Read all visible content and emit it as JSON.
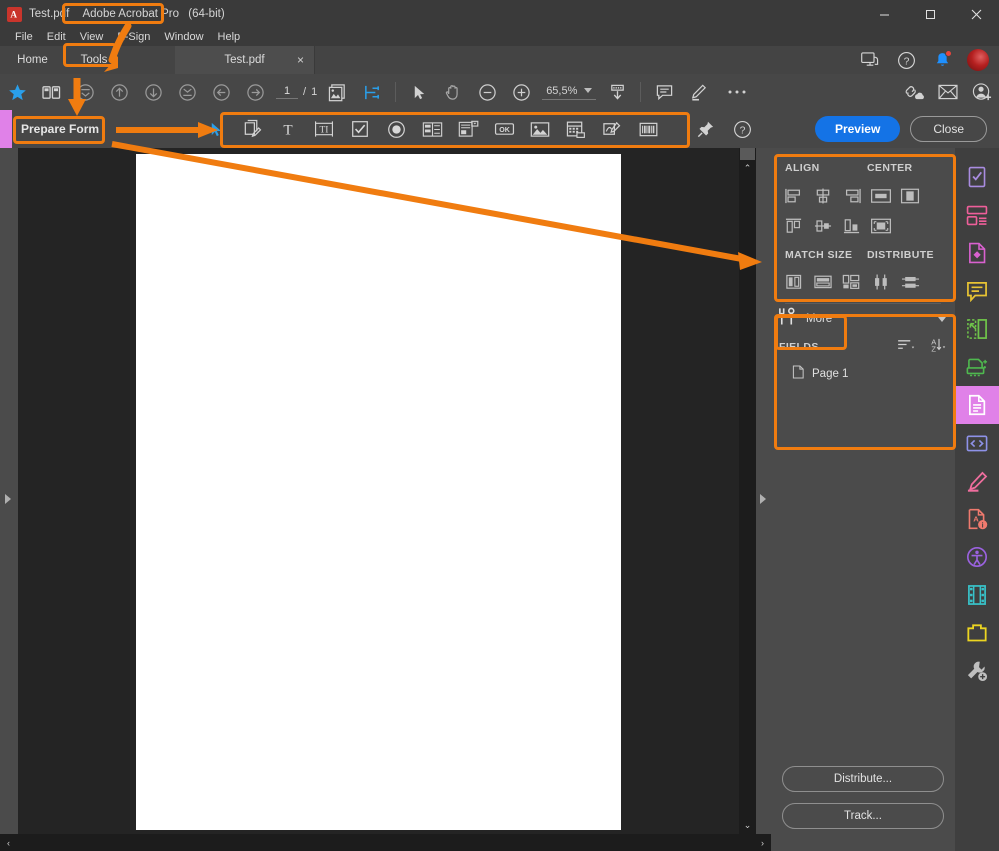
{
  "window": {
    "app_icon": "acrobat-logo-icon",
    "title_file": "Test.pdf",
    "title_app": "Adobe Acrobat Pro",
    "title_suffix": "(64-bit)",
    "minimize": "minimize-icon",
    "maximize": "maximize-icon",
    "close": "close-icon"
  },
  "menu": {
    "items": [
      {
        "label": "File"
      },
      {
        "label": "Edit"
      },
      {
        "label": "View"
      },
      {
        "label": "E-Sign"
      },
      {
        "label": "Window"
      },
      {
        "label": "Help"
      }
    ]
  },
  "tabs": {
    "home": "Home",
    "tools": "Tools",
    "document": "Test.pdf",
    "close_glyph": "×",
    "right_icons": [
      "screen-share-icon",
      "help-circle-icon",
      "notification-bell-icon",
      "user-avatar"
    ]
  },
  "toolbar": {
    "icons": [
      "star-icon",
      "thumbnails-icon",
      "scroll-top-icon",
      "page-up-icon",
      "page-down-icon",
      "scroll-bottom-icon",
      "previous-view-icon",
      "next-view-icon"
    ],
    "page_current": "1",
    "page_separator": "/",
    "page_total": "1",
    "view_icons": [
      "page-thumbnail-icon",
      "fit-page-icon"
    ],
    "cursor_icons": [
      "select-tool-icon",
      "hand-tool-icon",
      "zoom-out-icon",
      "zoom-in-icon"
    ],
    "zoom_value": "65,5%",
    "zoom_caret": "chevron-down-icon",
    "after_zoom_icons": [
      "fit-width-icon"
    ],
    "annot_icons": [
      "comment-icon",
      "highlight-icon"
    ],
    "more_glyph": "•••",
    "share_icons": [
      "share-link-icon",
      "email-icon",
      "add-person-icon"
    ]
  },
  "prepare_form": {
    "label": "Prepare Form",
    "field_tools": [
      "select-object-icon",
      "add-field-icon",
      "text-tool-icon",
      "text-field-icon",
      "checkbox-field-icon",
      "radio-button-field-icon",
      "list-box-field-icon",
      "dropdown-field-icon",
      "button-field-icon",
      "image-field-icon",
      "date-field-icon",
      "signature-field-icon",
      "barcode-field-icon"
    ],
    "pin_icon": "pin-icon",
    "help_icon": "help-circle-icon",
    "preview_button": "Preview",
    "close_button": "Close"
  },
  "right_panel": {
    "align_title": "ALIGN",
    "center_title": "CENTER",
    "match_size_title": "MATCH SIZE",
    "distribute_title": "DISTRIBUTE",
    "align_icons": [
      "align-left-icon",
      "align-vertical-center-icon",
      "align-right-icon",
      "align-top-icon",
      "align-horizontal-center-icon",
      "align-bottom-icon"
    ],
    "center_icons": [
      "center-vertically-icon",
      "center-horizontally-icon",
      "center-both-icon"
    ],
    "match_size_icons": [
      "match-width-icon",
      "match-height-icon",
      "match-both-icon"
    ],
    "distribute_icons": [
      "distribute-vertically-icon",
      "distribute-horizontally-icon"
    ],
    "more_label": "More",
    "more_icon": "tools-wrench-icon",
    "more_caret": "chevron-down-icon",
    "fields_title": "FIELDS",
    "fields_sort_icon": "sort-order-icon",
    "fields_az_icon": "sort-alphabetical-icon",
    "field_tree": [
      {
        "label": "Page 1",
        "icon": "page-icon"
      }
    ],
    "distribute_button": "Distribute...",
    "track_button": "Track..."
  },
  "right_rail": {
    "items": [
      {
        "name": "prepare-form-rail-icon",
        "color": "#a98ce0"
      },
      {
        "name": "create-pdf-rail-icon",
        "color": "#ef5f9a"
      },
      {
        "name": "export-pdf-rail-icon",
        "color": "#d961cf"
      },
      {
        "name": "comment-rail-icon",
        "color": "#e8c433"
      },
      {
        "name": "organize-pages-rail-icon",
        "color": "#6fc44a"
      },
      {
        "name": "scan-ocr-rail-icon",
        "color": "#4fb84f"
      },
      {
        "name": "edit-pdf-rail-icon",
        "color": "#ffffff",
        "active": true
      },
      {
        "name": "code-rail-icon",
        "color": "#8e92e8"
      },
      {
        "name": "fill-sign-rail-icon",
        "color": "#ef6e9e"
      },
      {
        "name": "protect-rail-icon",
        "color": "#ef7a6e"
      },
      {
        "name": "accessibility-rail-icon",
        "color": "#9b62e0"
      },
      {
        "name": "rich-media-rail-icon",
        "color": "#38c2c9"
      },
      {
        "name": "stamp-rail-icon",
        "color": "#ecd521"
      },
      {
        "name": "more-tools-rail-icon",
        "color": "#bfbfbf"
      }
    ]
  },
  "scrollbars": {
    "h_left": "‹",
    "h_right": "›",
    "v_up": "⌃",
    "v_down": "⌄"
  },
  "annotations": {
    "accent_color": "#f07c10",
    "boxes": [
      "title-app-highlight",
      "tools-tab-highlight",
      "prepare-form-highlight",
      "field-tools-highlight",
      "align-panel-highlight",
      "more-button-highlight"
    ],
    "arrows": [
      "title-to-tools-arrow",
      "tools-to-prepare-form-arrow",
      "prepare-form-to-tools-arrow",
      "prepare-form-to-panel-arrow"
    ]
  }
}
